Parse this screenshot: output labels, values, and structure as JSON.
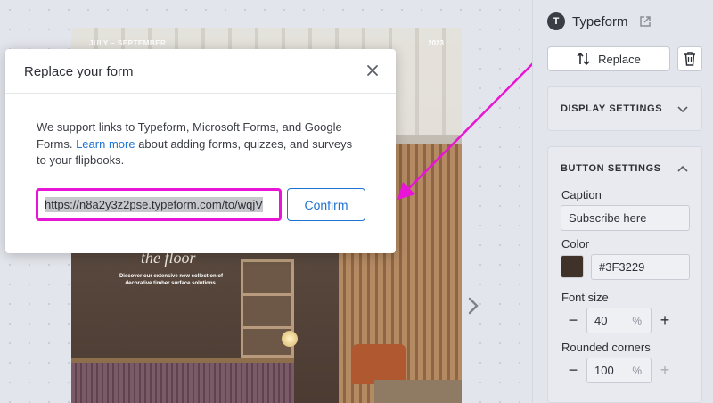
{
  "flipbook": {
    "date_range": "JULY – SEPTEMBER",
    "year": "2023",
    "heading": "the floor",
    "subtext": "Discover our extensive new collection of decorative timber surface solutions."
  },
  "modal": {
    "title": "Replace your form",
    "description_before": "We support links to Typeform, Microsoft Forms, and Google Forms.",
    "learn_more_link": "Learn more",
    "description_after": "about adding forms, quizzes, and surveys to your flipbooks.",
    "url_value": "https://n8a2y3z2pse.typeform.com/to/wqjV",
    "confirm_label": "Confirm"
  },
  "sidebar": {
    "source_initial": "T",
    "source_name": "Typeform",
    "replace_label": "Replace",
    "display_settings_title": "DISPLAY SETTINGS",
    "button_settings_title": "BUTTON SETTINGS",
    "caption_label": "Caption",
    "caption_value": "Subscribe here",
    "color_label": "Color",
    "color_value": "#3F3229",
    "font_size_label": "Font size",
    "font_size_value": "40",
    "font_size_unit": "%",
    "rounded_corners_label": "Rounded corners",
    "rounded_corners_value": "100",
    "rounded_corners_unit": "%"
  },
  "colors": {
    "accent": "#1f73d0",
    "highlight": "#e815d6",
    "swatch": "#3F3229"
  }
}
